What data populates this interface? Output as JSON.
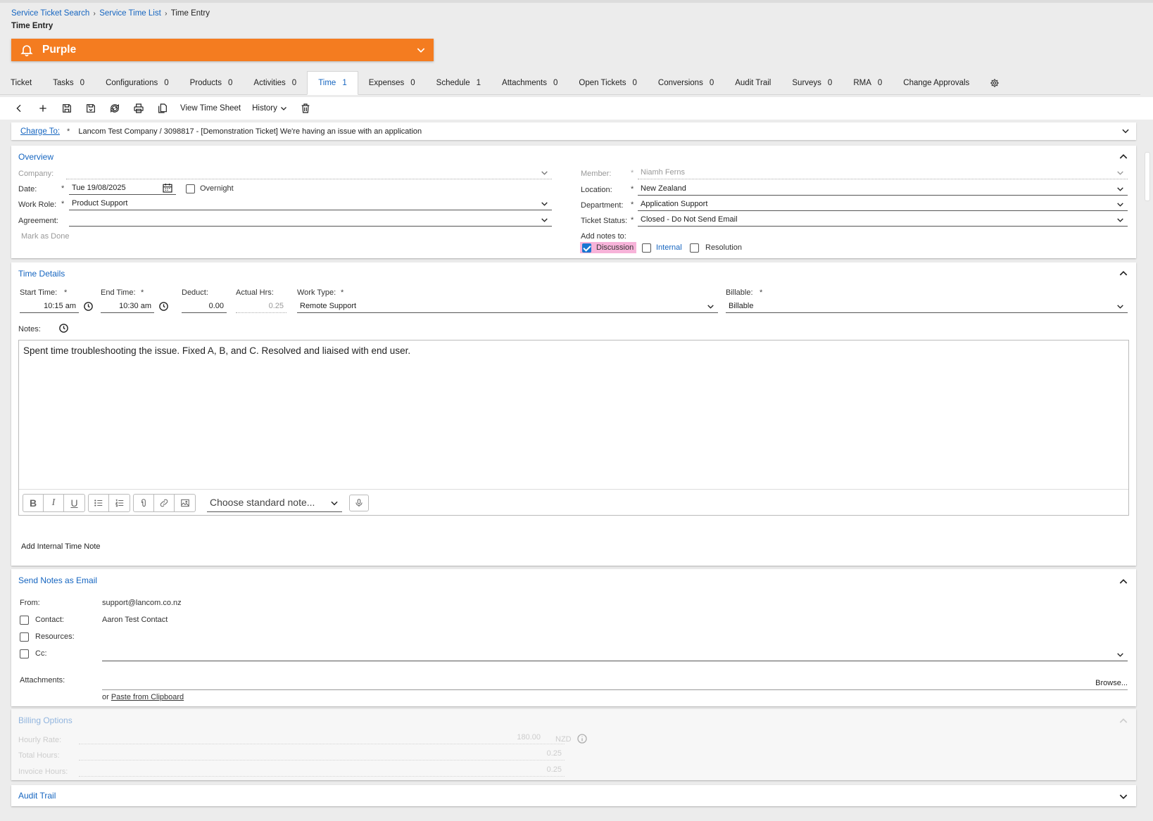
{
  "breadcrumb": {
    "items": [
      "Service Ticket Search",
      "Service Time List"
    ],
    "current": "Time Entry"
  },
  "page_title": "Time Entry",
  "banner": {
    "label": "Purple",
    "color": "#f47c20"
  },
  "tabs": [
    {
      "label": "Ticket",
      "count": ""
    },
    {
      "label": "Tasks",
      "count": "0"
    },
    {
      "label": "Configurations",
      "count": "0"
    },
    {
      "label": "Products",
      "count": "0"
    },
    {
      "label": "Activities",
      "count": "0"
    },
    {
      "label": "Time",
      "count": "1"
    },
    {
      "label": "Expenses",
      "count": "0"
    },
    {
      "label": "Schedule",
      "count": "1"
    },
    {
      "label": "Attachments",
      "count": "0"
    },
    {
      "label": "Open Tickets",
      "count": "0"
    },
    {
      "label": "Conversions",
      "count": "0"
    },
    {
      "label": "Audit Trail",
      "count": ""
    },
    {
      "label": "Surveys",
      "count": "0"
    },
    {
      "label": "RMA",
      "count": "0"
    },
    {
      "label": "Change Approvals",
      "count": ""
    }
  ],
  "active_tab": "Time",
  "toolbar": {
    "view_time_sheet": "View Time Sheet",
    "history": "History"
  },
  "charge_to": {
    "label": "Charge To:",
    "required": "*",
    "value": "Lancom Test Company / 3098817 - [Demonstration Ticket] We're having an issue with an application"
  },
  "overview": {
    "title": "Overview",
    "company_label": "Company:",
    "company_value": "",
    "date_label": "Date:",
    "date_value": "Tue 19/08/2025",
    "overnight_label": "Overnight",
    "overnight_checked": false,
    "work_role_label": "Work Role:",
    "work_role_value": "Product Support",
    "agreement_label": "Agreement:",
    "agreement_value": "",
    "mark_as_done": "Mark as Done",
    "member_label": "Member:",
    "member_value": "Niamh Ferns",
    "location_label": "Location:",
    "location_value": "New Zealand",
    "department_label": "Department:",
    "department_value": "Application Support",
    "ticket_status_label": "Ticket Status:",
    "ticket_status_value": "Closed - Do Not Send Email",
    "add_notes_label": "Add notes to:",
    "discussion_label": "Discussion",
    "discussion_checked": true,
    "internal_label": "Internal",
    "internal_checked": false,
    "resolution_label": "Resolution",
    "resolution_checked": false
  },
  "time_details": {
    "title": "Time Details",
    "start_label": "Start Time:",
    "start_value": "10:15 am",
    "end_label": "End Time:",
    "end_value": "10:30 am",
    "deduct_label": "Deduct:",
    "deduct_value": "0.00",
    "actual_label": "Actual Hrs:",
    "actual_value": "0.25",
    "work_type_label": "Work Type:",
    "work_type_value": "Remote Support",
    "billable_label": "Billable:",
    "billable_value": "Billable",
    "notes_label": "Notes:",
    "notes_text": "Spent time troubleshooting the issue. Fixed A, B, and C. Resolved and liaised with end user.",
    "standard_note_placeholder": "Choose standard note...",
    "add_internal_note": "Add Internal Time Note"
  },
  "send_email": {
    "title": "Send Notes as Email",
    "from_label": "From:",
    "from_value": "support@lancom.co.nz",
    "contact_label": "Contact:",
    "contact_value": "Aaron Test Contact",
    "resources_label": "Resources:",
    "cc_label": "Cc:",
    "attachments_label": "Attachments:",
    "browse": "Browse...",
    "or": "or",
    "paste": "Paste from Clipboard"
  },
  "billing": {
    "title": "Billing Options",
    "hourly_rate_label": "Hourly Rate:",
    "hourly_rate_value": "180.00",
    "currency": "NZD",
    "total_hours_label": "Total Hours:",
    "total_hours_value": "0.25",
    "invoice_hours_label": "Invoice Hours:",
    "invoice_hours_value": "0.25"
  },
  "audit_trail": {
    "title": "Audit Trail"
  },
  "colors": {
    "accent": "#1565c0",
    "banner": "#f47c20",
    "highlight": "#f7b3d9"
  }
}
